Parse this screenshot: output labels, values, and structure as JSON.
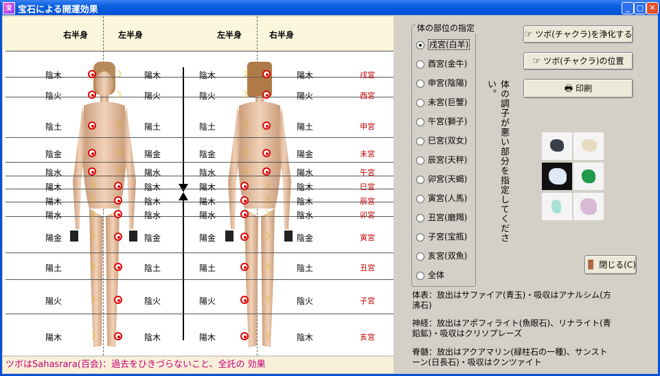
{
  "window": {
    "title": "宝石による開運効果",
    "app_icon_text": "宝"
  },
  "chart": {
    "header": {
      "front_right": "右半身",
      "front_left": "左半身",
      "back_left": "左半身",
      "back_right": "右半身"
    },
    "rows": [
      {
        "left": "陰木",
        "mid": "陽木",
        "back_left": "陰木",
        "back_right": "陽木",
        "zodiac": "戌宮"
      },
      {
        "left": "陰火",
        "mid": "陽火",
        "back_left": "陰火",
        "back_right": "陽火",
        "zodiac": "酉宮"
      },
      {
        "left": "陰土",
        "mid": "陽土",
        "back_left": "陰土",
        "back_right": "陽土",
        "zodiac": "申宮"
      },
      {
        "left": "陰金",
        "mid": "陽金",
        "back_left": "陰金",
        "back_right": "陽金",
        "zodiac": "未宮"
      },
      {
        "left": "陰水",
        "mid": "陽水",
        "back_left": "陰水",
        "back_right": "陽水",
        "zodiac": "午宮"
      },
      {
        "left": "陽木",
        "mid": "陰木",
        "back_left": "陽木",
        "back_right": "陰木",
        "zodiac": "巳宮"
      },
      {
        "left": "陽木",
        "mid": "陰木",
        "back_left": "陽木",
        "back_right": "陰木",
        "zodiac": "辰宮"
      },
      {
        "left": "陽水",
        "mid": "陰水",
        "back_left": "陽水",
        "back_right": "陰水",
        "zodiac": "卯宮"
      },
      {
        "left": "陽金",
        "mid": "陰金",
        "back_left": "陽金",
        "back_right": "陰金",
        "zodiac": "寅宮"
      },
      {
        "left": "陽土",
        "mid": "陰土",
        "back_left": "陽土",
        "back_right": "陰土",
        "zodiac": "丑宮"
      },
      {
        "left": "陽火",
        "mid": "陰火",
        "back_left": "陽火",
        "back_right": "陰火",
        "zodiac": "子宮"
      },
      {
        "left": "陽木",
        "mid": "陰木",
        "back_left": "陽木",
        "back_right": "陰木",
        "zodiac": "亥宮"
      }
    ]
  },
  "status_text": "ツボはSahasrara(百会)：過去をひきづらないこと、全託の 効果",
  "body_part_group": {
    "title": "体の部位の指定",
    "options": [
      {
        "label": "戌宮(白羊)",
        "selected": true
      },
      {
        "label": "酉宮(金牛)",
        "selected": false
      },
      {
        "label": "申宮(陰陽)",
        "selected": false
      },
      {
        "label": "未宮(巨蟹)",
        "selected": false
      },
      {
        "label": "午宮(獅子)",
        "selected": false
      },
      {
        "label": "巳宮(双女)",
        "selected": false
      },
      {
        "label": "辰宮(天秤)",
        "selected": false
      },
      {
        "label": "卯宮(天蝎)",
        "selected": false
      },
      {
        "label": "寅宮(人馬)",
        "selected": false
      },
      {
        "label": "丑宮(磨羯)",
        "selected": false
      },
      {
        "label": "子宮(宝瓶)",
        "selected": false
      },
      {
        "label": "亥宮(双魚)",
        "selected": false
      },
      {
        "label": "全体",
        "selected": false
      }
    ]
  },
  "vertical_hint": "体の調子が悪い部分を指定してください。",
  "buttons": {
    "purify": "ツボ(チャクラ)を浄化する",
    "position": "ツボ(チャクラ)の位置",
    "print": "印刷",
    "close": "閉じる(C)"
  },
  "info": {
    "line1": "体表：放出はサファイア(青玉)・吸収はアナルシム(方沸石)",
    "line2": "神経：放出はアポフィライト(魚眼石)、リナライト(青鉛鉱)・吸収はクリソプレーズ",
    "line3": "脊髄：放出はアクアマリン(緑柱石の一種)、サンストーン(日長石)・吸収はクンツァイト"
  },
  "colors": {
    "titlebar": "#0450d4",
    "zodiac_text": "#c00000",
    "status_text": "#c0007a",
    "chart_header_bg": "#fbf7dc"
  }
}
